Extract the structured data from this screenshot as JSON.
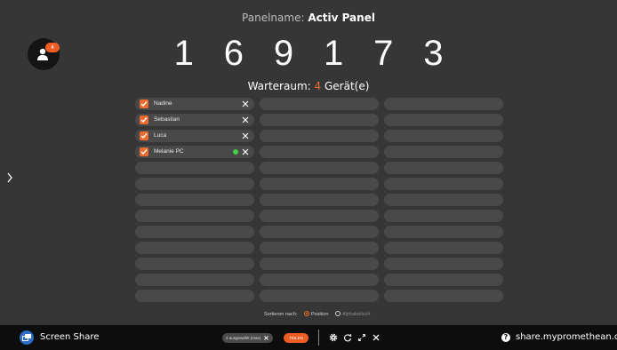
{
  "header": {
    "panel_label": "Panelname:",
    "panel_name": "Activ Panel",
    "waiting_count_badge": "4",
    "code_digits": [
      "1",
      "6",
      "9",
      "1",
      "7",
      "3"
    ],
    "waiting_prefix": "Warteraum:",
    "waiting_count": "4",
    "waiting_suffix": "Gerät(e)"
  },
  "devices": [
    {
      "name": "Nadine",
      "checked": true,
      "online": false
    },
    {
      "name": "Sebastian",
      "checked": true,
      "online": false
    },
    {
      "name": "Luca",
      "checked": true,
      "online": false
    },
    {
      "name": "Melanie PC",
      "checked": true,
      "online": true
    }
  ],
  "sort": {
    "label": "Sortieren nach:",
    "options": [
      "Position",
      "Alphabetisch"
    ],
    "selected": "Position"
  },
  "bottombar": {
    "app_label": "Screen Share",
    "selected_pill": "4 ausgewählt (max)",
    "share_label": "TEILEN",
    "url": "share.mypromethean.com"
  },
  "colors": {
    "accent": "#ee6b2d",
    "background": "#363636",
    "slot": "#494949",
    "bar": "#0d0d0d",
    "online": "#3fd24a"
  },
  "icons": [
    "person-icon",
    "chevron-right-icon",
    "checkbox-icon",
    "close-icon",
    "screen-share-icon",
    "gear-icon",
    "refresh-icon",
    "expand-icon",
    "help-icon"
  ]
}
